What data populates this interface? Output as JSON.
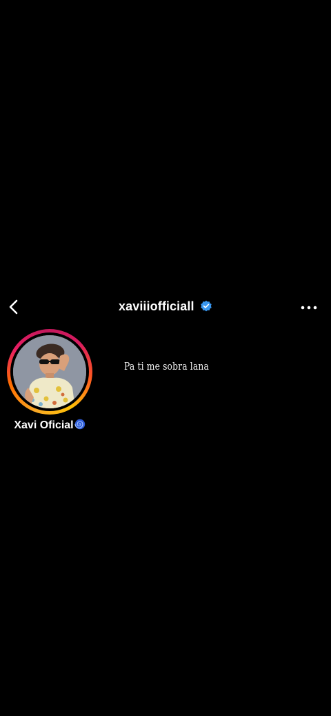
{
  "header": {
    "username": "xaviiiofficiall",
    "verified": true,
    "back_icon": "chevron-left-icon",
    "more_icon": "more-horizontal-icon",
    "verified_color": "#3897f0"
  },
  "story": {
    "display_name": "Xavi Oficial",
    "name_emoji_icon": "cyclone-icon",
    "ring_colors": [
      "#f9a825",
      "#e91e63",
      "#c2185b"
    ]
  },
  "post": {
    "caption": "Pa ti me sobra lana"
  }
}
